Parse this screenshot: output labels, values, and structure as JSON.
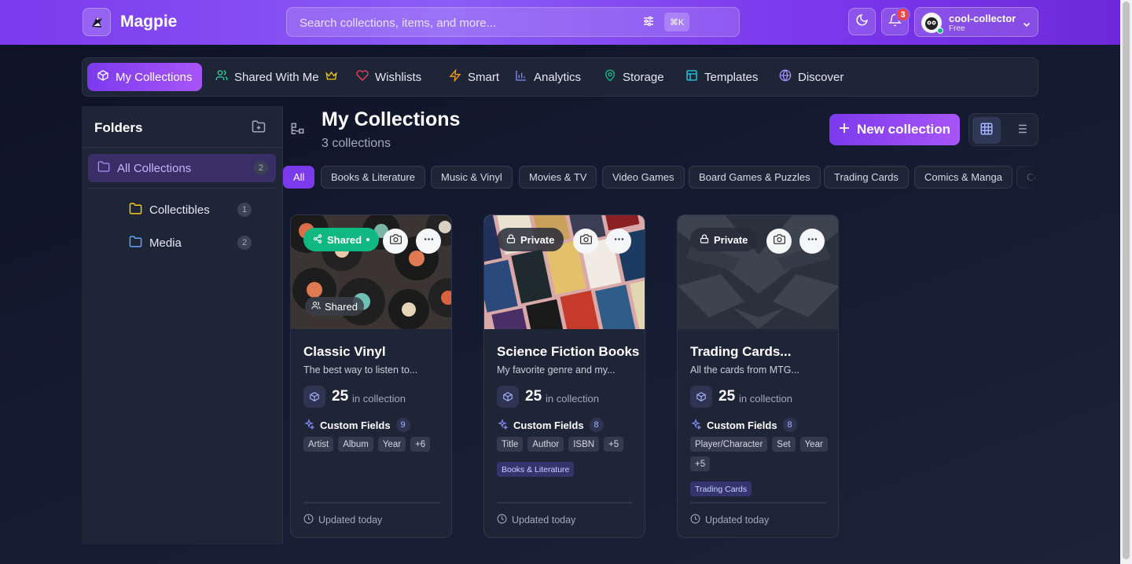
{
  "app": {
    "name": "Magpie"
  },
  "search": {
    "placeholder": "Search collections, items, and more...",
    "shortcut": "⌘K"
  },
  "notifications": {
    "count": "3"
  },
  "user": {
    "name": "cool-collector",
    "plan": "Free"
  },
  "nav": {
    "items": [
      {
        "label": "My Collections",
        "icon": "box-icon",
        "active": true
      },
      {
        "label": "Shared With Me",
        "icon": "users-icon"
      },
      {
        "label": "Wishlists",
        "icon": "heart-icon"
      },
      {
        "label": "Smart",
        "icon": "lightning-icon"
      },
      {
        "label": "Analytics",
        "icon": "bar-chart-icon"
      },
      {
        "label": "Storage",
        "icon": "map-pin-icon"
      },
      {
        "label": "Templates",
        "icon": "layout-icon"
      },
      {
        "label": "Discover",
        "icon": "globe-icon"
      }
    ]
  },
  "sidebar": {
    "title": "Folders",
    "folders": [
      {
        "label": "All Collections",
        "count": "2",
        "active": true
      },
      {
        "label": "Collectibles",
        "count": "1"
      },
      {
        "label": "Media",
        "count": "2"
      }
    ]
  },
  "main": {
    "title": "My Collections",
    "subtitle": "3 collections",
    "new_button": "New collection"
  },
  "categories": [
    "All",
    "Books & Literature",
    "Music & Vinyl",
    "Movies & TV",
    "Video Games",
    "Board Games & Puzzles",
    "Trading Cards",
    "Comics & Manga",
    "Co"
  ],
  "cards": [
    {
      "title": "Classic Vinyl",
      "description": "The best way to listen to...",
      "visibility": "Shared",
      "image_tag": "Shared",
      "count": "25",
      "count_label": "in collection",
      "custom_fields_label": "Custom Fields",
      "custom_fields_count": "9",
      "fields": [
        "Artist",
        "Album",
        "Year",
        "+6"
      ],
      "category": "",
      "updated": "Updated today"
    },
    {
      "title": "Science Fiction Books",
      "description": "My favorite genre and my...",
      "visibility": "Private",
      "count": "25",
      "count_label": "in collection",
      "custom_fields_label": "Custom Fields",
      "custom_fields_count": "8",
      "fields": [
        "Title",
        "Author",
        "ISBN",
        "+5"
      ],
      "category": "Books & Literature",
      "updated": "Updated today"
    },
    {
      "title": "Trading Cards...",
      "description": "All the cards from MTG...",
      "visibility": "Private",
      "count": "25",
      "count_label": "in collection",
      "custom_fields_label": "Custom Fields",
      "custom_fields_count": "8",
      "fields": [
        "Player/Character",
        "Set",
        "Year",
        "+5"
      ],
      "category": "Trading Cards",
      "updated": "Updated today"
    }
  ],
  "colors": {
    "accent": "#7c3aed",
    "shared": "#10b981",
    "badge": "#ef4444"
  }
}
